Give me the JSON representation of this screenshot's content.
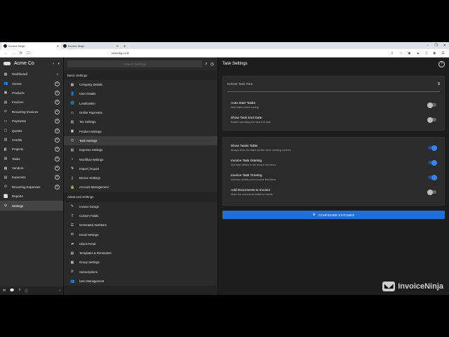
{
  "browser": {
    "tabs": [
      {
        "label": "Invoice Ninja",
        "active": true
      },
      {
        "label": "Invoice Ninja",
        "active": false
      }
    ],
    "url": "invoicing.co/#/",
    "new_tab": "+",
    "win_controls": [
      "–",
      "❐",
      "✕"
    ]
  },
  "sidebar": {
    "company": "Acme Co",
    "items": [
      {
        "label": "Dashboard",
        "icon": "dashboard-icon",
        "glyph": "▦",
        "search": true
      },
      {
        "label": "Clients",
        "icon": "clients-icon",
        "glyph": "👥",
        "plus": true
      },
      {
        "label": "Products",
        "icon": "products-icon",
        "glyph": "▣",
        "plus": true
      },
      {
        "label": "Invoices",
        "icon": "invoices-icon",
        "glyph": "▤",
        "plus": true
      },
      {
        "label": "Recurring Invoices",
        "icon": "recurring-invoices-icon",
        "glyph": "⟳",
        "plus": true
      },
      {
        "label": "Payments",
        "icon": "payments-icon",
        "glyph": "▭",
        "plus": true
      },
      {
        "label": "Quotes",
        "icon": "quotes-icon",
        "glyph": "▢",
        "plus": true
      },
      {
        "label": "Credits",
        "icon": "credits-icon",
        "glyph": "▥",
        "plus": true
      },
      {
        "label": "Projects",
        "icon": "projects-icon",
        "glyph": "◧",
        "plus": true
      },
      {
        "label": "Tasks",
        "icon": "tasks-icon",
        "glyph": "▤",
        "plus": true
      },
      {
        "label": "Vendors",
        "icon": "vendors-icon",
        "glyph": "▦",
        "plus": true
      },
      {
        "label": "Expenses",
        "icon": "expenses-icon",
        "glyph": "▤",
        "plus": true
      },
      {
        "label": "Recurring Expenses",
        "icon": "recurring-expenses-icon",
        "glyph": "⟳",
        "plus": true
      },
      {
        "label": "Reports",
        "icon": "reports-icon",
        "glyph": "📈",
        "plus": false
      },
      {
        "label": "Settings",
        "icon": "settings-icon",
        "glyph": "⚙",
        "plus": false,
        "active": true
      }
    ],
    "bottom": [
      "✉",
      "💬",
      "?",
      "ⓘ"
    ],
    "collapse": "‹"
  },
  "settings_nav": {
    "search_placeholder": "Search Settings",
    "basic_header": "Basic Settings",
    "basic_items": [
      {
        "label": "Company Details",
        "glyph": "▦"
      },
      {
        "label": "User Details",
        "glyph": "👤"
      },
      {
        "label": "Localization",
        "glyph": "🌐"
      },
      {
        "label": "Online Payments",
        "glyph": "▭"
      },
      {
        "label": "Tax Settings",
        "glyph": "▥"
      },
      {
        "label": "Product Settings",
        "glyph": "▣"
      },
      {
        "label": "Task Settings",
        "glyph": "◷",
        "active": true
      },
      {
        "label": "Expense Settings",
        "glyph": "▤"
      },
      {
        "label": "Workflow Settings",
        "glyph": "⑂"
      },
      {
        "label": "Import | Export",
        "glyph": "⇅"
      },
      {
        "label": "Device Settings",
        "glyph": "▯"
      },
      {
        "label": "Account Management",
        "glyph": "🔒"
      }
    ],
    "advanced_header": "Advanced Settings",
    "advanced_items": [
      {
        "label": "Invoice Design",
        "glyph": "✎"
      },
      {
        "label": "Custom Fields",
        "glyph": "T"
      },
      {
        "label": "Generated Numbers",
        "glyph": "☰"
      },
      {
        "label": "Email Settings",
        "glyph": "✉"
      },
      {
        "label": "Client Portal",
        "glyph": "☁"
      },
      {
        "label": "Templates & Reminders",
        "glyph": "▤"
      },
      {
        "label": "Group Settings",
        "glyph": "▦"
      },
      {
        "label": "Subscriptions",
        "glyph": "⟳"
      },
      {
        "label": "User Management",
        "glyph": "👥"
      }
    ]
  },
  "main": {
    "title": "Task Settings",
    "rate_label": "Default Task Rate",
    "rate_suffix": "$",
    "card1": [
      {
        "label": "Auto Start Tasks",
        "sub": "Start tasks before saving",
        "on": false
      },
      {
        "label": "Show Task End Date",
        "sub": "Enable specifying the task end date",
        "on": false
      }
    ],
    "card2": [
      {
        "label": "Show Tasks Table",
        "sub": "Always show the tasks section when creating invoices",
        "on": true
      },
      {
        "label": "Invoice Task Datelog",
        "sub": "Add date details to the invoice line items",
        "on": true
      },
      {
        "label": "Invoice Task Timelog",
        "sub": "Add time details to the invoice line items",
        "on": true
      },
      {
        "label": "Add Documents to Invoice",
        "sub": "Make the documents visible to clients",
        "on": false
      }
    ],
    "button": "CONFIGURE STATUSES"
  },
  "watermark": "InvoiceNinja",
  "colors": {
    "accent": "#1e6fd9",
    "toggle_on": "#3b82f6"
  }
}
